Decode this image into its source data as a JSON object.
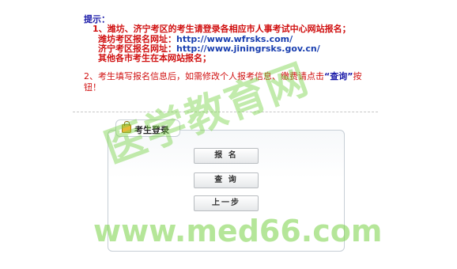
{
  "notice": {
    "title": "提示：",
    "item1": "1、潍坊、济宁考区的考生请登录各相应市人事考试中心网站报名；",
    "weifang_label": "潍坊考区报名网址：",
    "weifang_url": "http://www.wfrsks.com/",
    "jining_label": "济宁考区报名网址：",
    "jining_url": "http://www.jiningrsks.gov.cn/",
    "other_line": "其他各市考生在本网站报名；",
    "item2_prefix": "2、考生填写报名信息后，如需修改个人报考信息、缴费请点击",
    "item2_query": "“查询”",
    "item2_suffix": "按钮！"
  },
  "login": {
    "tab_label": "考生登录",
    "icon": "lock-icon",
    "register_label": "报 名",
    "query_label": "查 询",
    "back_label": "上一步"
  },
  "watermark": {
    "cn_text": "医学教育网",
    "url_text": "www.med66.com"
  },
  "colors": {
    "title": "#1a1aa8",
    "notice_red": "#d01010",
    "url_blue": "#1a3fb0",
    "watermark_green": "#78d246"
  }
}
